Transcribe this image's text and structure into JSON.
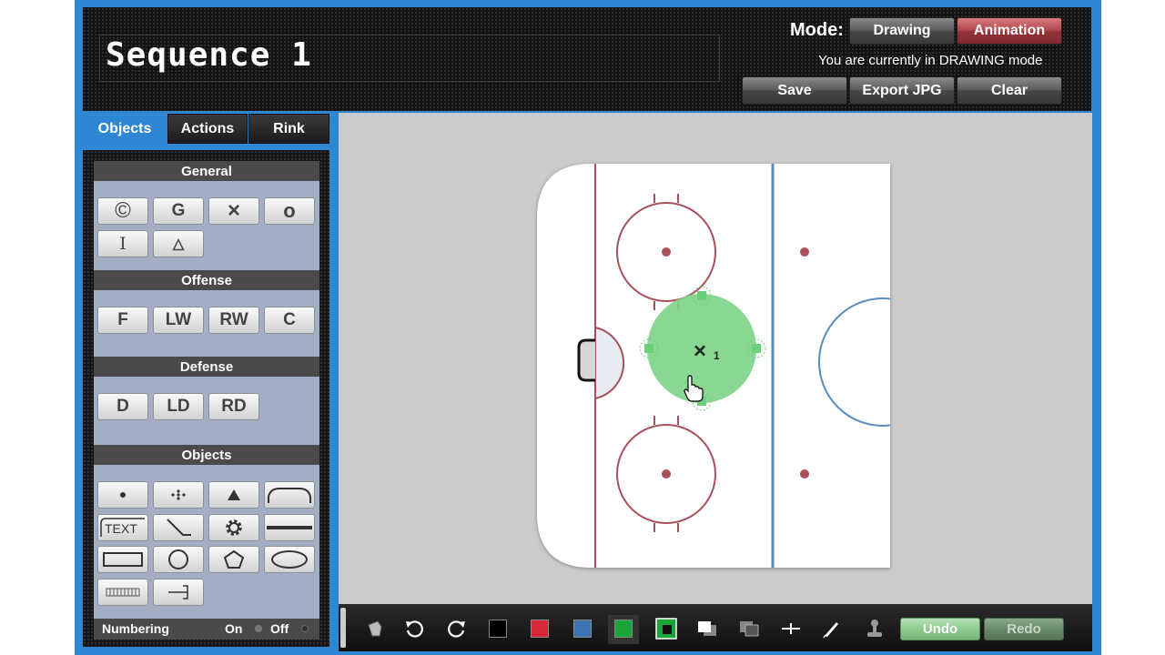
{
  "header": {
    "sequence_title": "Sequence 1",
    "mode_label": "Mode:",
    "mode_status": "You are currently in DRAWING mode",
    "drawing_button": "Drawing",
    "animation_button": "Animation",
    "save_button": "Save",
    "export_button": "Export JPG",
    "clear_button": "Clear"
  },
  "tabs": [
    {
      "label": "Objects",
      "active": true
    },
    {
      "label": "Actions",
      "active": false
    },
    {
      "label": "Rink",
      "active": false
    }
  ],
  "sidebar": {
    "general": {
      "title": "General",
      "items": [
        "©",
        "G",
        "×",
        "o",
        "I",
        "△"
      ]
    },
    "offense": {
      "title": "Offense",
      "items": [
        "F",
        "LW",
        "RW",
        "C"
      ]
    },
    "defense": {
      "title": "Defense",
      "items": [
        "D",
        "LD",
        "RD"
      ]
    },
    "objects": {
      "title": "Objects",
      "text_tool": "TEXT",
      "items": [
        "dot",
        "dots",
        "cone",
        "arc",
        "text",
        "stick",
        "gear",
        "line",
        "rectangle",
        "circle",
        "pentagon",
        "ellipse",
        "ladder",
        "net"
      ]
    },
    "numbering": {
      "label": "Numbering",
      "on": "On",
      "off": "Off"
    }
  },
  "rink": {
    "selected_player_label": "×",
    "selected_player_number": "1",
    "selection_color": "#7fd48a",
    "line_red": "#a8505a",
    "line_blue": "#5b8cc0"
  },
  "toolbar": {
    "undo_label": "Undo",
    "redo_label": "Redo",
    "colors": [
      "#000000",
      "#d7283a",
      "#3c73b0",
      "#1aa43a"
    ],
    "icons": [
      "eraser-icon",
      "rotate-left-icon",
      "rotate-right-icon",
      "fill-color-icon",
      "bring-front-icon",
      "send-back-icon",
      "plus-icon",
      "pen-icon",
      "stamp-icon"
    ]
  }
}
